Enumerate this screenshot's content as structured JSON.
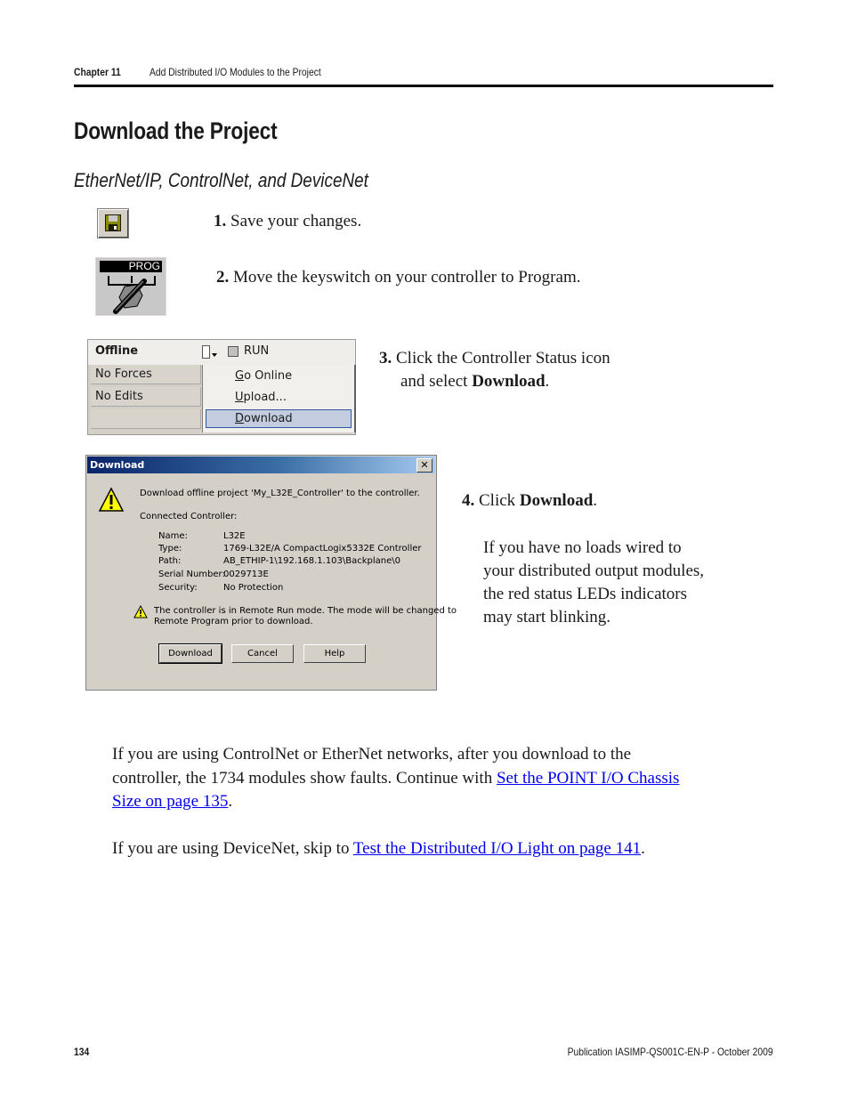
{
  "header": {
    "chapter": "Chapter 11",
    "chapter_title": "Add Distributed I/O Modules to the Project"
  },
  "page_title": "Download the Project",
  "subtitle": "EtherNet/IP, ControlNet, and DeviceNet",
  "steps": [
    {
      "num": "1.",
      "text": "Save your changes.",
      "icon": "save-icon"
    },
    {
      "num": "2.",
      "text": "Move the keyswitch on your controller to Program.",
      "icon": "keyswitch-icon",
      "icon_label": "PROG"
    },
    {
      "num": "3.",
      "text_before": "Click the Controller Status icon",
      "text_line2": "and select ",
      "bold": "Download",
      "text_after": "."
    },
    {
      "num": "4.",
      "text_before": "Click ",
      "bold": "Download",
      "text_after": ".",
      "note_lines": [
        "If you have no loads wired to",
        "your distributed output modules,",
        "the red status LEDs indicators",
        "may start blinking."
      ]
    }
  ],
  "status_panel": {
    "mode": "Offline",
    "run_label": "RUN",
    "forces": "No Forces",
    "edits": "No Edits",
    "menu": [
      {
        "accel": "G",
        "rest": "o Online"
      },
      {
        "accel": "U",
        "rest": "pload..."
      },
      {
        "accel": "D",
        "rest": "ownload",
        "selected": true
      }
    ]
  },
  "dialog": {
    "title": "Download",
    "close": "✕",
    "message": "Download offline project 'My_L32E_Controller' to the controller.",
    "connected_label": "Connected Controller:",
    "fields": [
      {
        "label": "Name:",
        "value": "L32E"
      },
      {
        "label": "Type:",
        "value": "1769-L32E/A CompactLogix5332E Controller"
      },
      {
        "label": "Path:",
        "value": "AB_ETHIP-1\\192.168.1.103\\Backplane\\0"
      },
      {
        "label": "Serial Number:",
        "value": "0029713E"
      },
      {
        "label": "Security:",
        "value": "No Protection"
      }
    ],
    "warning_line1": "The controller is in Remote Run mode. The mode will be changed to",
    "warning_line2": "Remote Program prior to download.",
    "buttons": {
      "download": "Download",
      "cancel": "Cancel",
      "help": "Help"
    }
  },
  "paragraphs": {
    "p1_line1": "If you are using ControlNet or EtherNet networks, after you download to the",
    "p1_line2": "controller, the 1734 modules show faults. Continue with ",
    "p1_link_a": "Set the POINT I/O Chassis ",
    "p1_link_b": "Size on page 135",
    "p1_end": ".",
    "p2_text": "If you are using DeviceNet, skip to ",
    "p2_link": "Test the Distributed I/O Light on page 141",
    "p2_end": "."
  },
  "footer": {
    "page_number": "134",
    "publication": "Publication IASIMP-QS001C-EN-P - October 2009"
  },
  "colors": {
    "link": "#0000ee",
    "dialog_title_start": "#0a246a",
    "dialog_title_end": "#a6caf0",
    "menu_selection": "#c4cce0"
  }
}
